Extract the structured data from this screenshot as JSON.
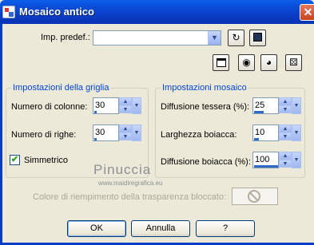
{
  "window": {
    "title": "Mosaico antico",
    "close_glyph": "✕"
  },
  "preset": {
    "label": "Imp. predef.:",
    "value": "",
    "arrow_icon": "chevron-down-icon",
    "reset_icon": "reset-icon",
    "save_icon": "floppy-disk-icon"
  },
  "toolbar": {
    "icons": [
      "preview-window-icon",
      "eye-preview-on-icon",
      "eye-preview-icon",
      "random-dice-icon"
    ]
  },
  "grid_group": {
    "title": "Impostazioni della griglia",
    "columns_label": "Numero di colonne:",
    "columns_value": "30",
    "rows_label": "Numero di righe:",
    "rows_value": "30",
    "symmetric_label": "Simmetrico",
    "symmetric_checked": true
  },
  "mosaic_group": {
    "title": "Impostazioni mosaico",
    "tile_diffusion_label": "Diffusione tessera (%):",
    "tile_diffusion_value": "25",
    "grout_width_label": "Larghezza boiacca:",
    "grout_width_value": "10",
    "grout_diffusion_label": "Diffusione boiacca (%):",
    "grout_diffusion_value": "100"
  },
  "watermark": {
    "name": "Pinuccia",
    "url": "www.maidiregrafica.eu"
  },
  "transparency_fill": {
    "label": "Colore di riempimento della trasparenza bloccato:"
  },
  "buttons": {
    "ok": "OK",
    "cancel": "Annulla",
    "help": "?"
  },
  "colors": {
    "title_bar": "#0a3dc7",
    "dialog_bg": "#ece9d8",
    "group_title": "#0046d5",
    "disabled_text": "#aca899"
  }
}
